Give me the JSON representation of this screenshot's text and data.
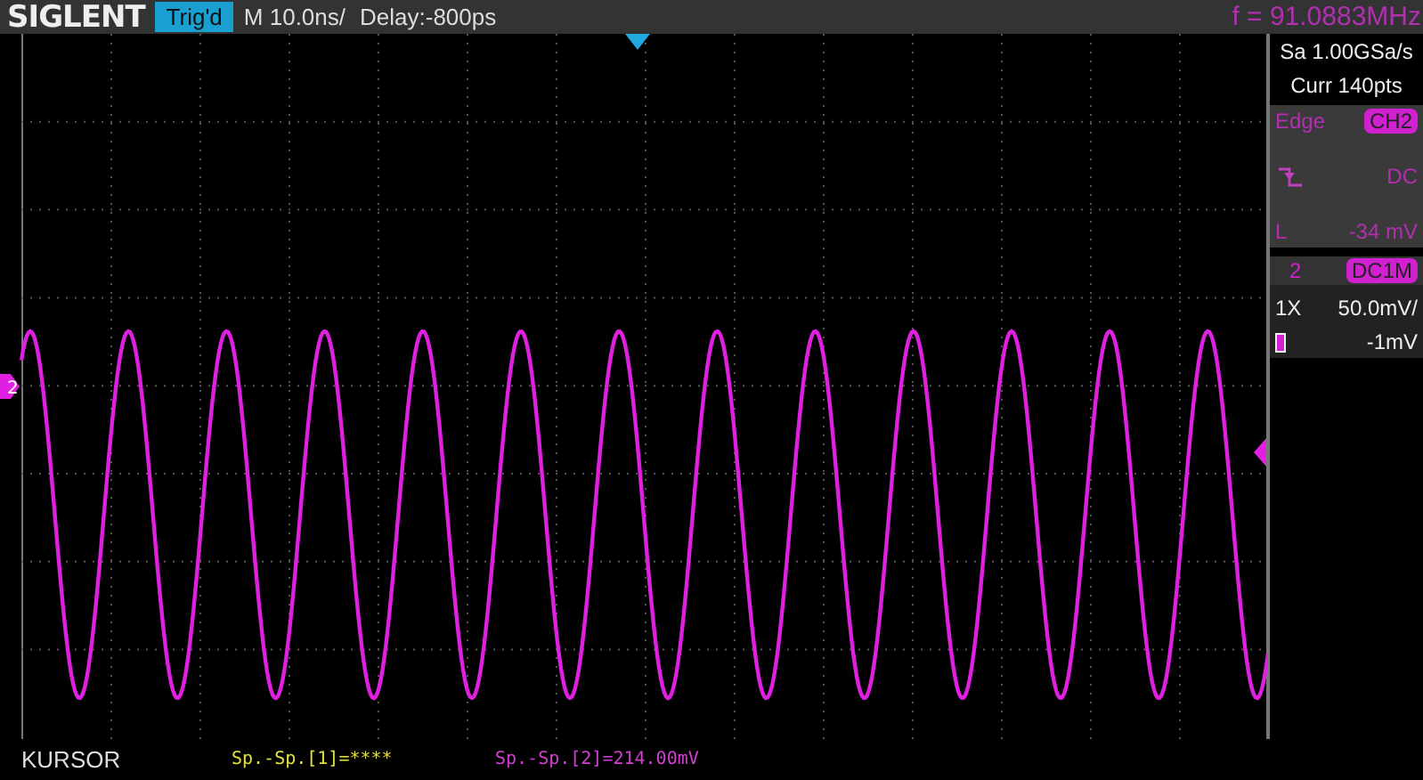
{
  "header": {
    "logo": "SIGLENT",
    "trigger_status": "Trig'd",
    "timebase": "M 10.0ns/",
    "delay": "Delay:-800ps",
    "frequency": "f = 91.0883MHz"
  },
  "acquisition": {
    "sample_rate": "Sa 1.00GSa/s",
    "memory": "Curr 140pts"
  },
  "trigger": {
    "type": "Edge",
    "source": "CH2",
    "coupling": "DC",
    "level_label": "L",
    "level_reading": "-34 mV"
  },
  "channel": {
    "number": "2",
    "coupling": "DC1M",
    "probe": "1X",
    "scale": "50.0mV/",
    "offset": "-1mV"
  },
  "screen": {
    "channel_marker": "2"
  },
  "status_bar": {
    "mode": "KURSOR",
    "readouts": [
      {
        "text": "Sp.-Sp.[1]=****",
        "color": "#e0e040"
      },
      {
        "text": "Sp.-Sp.[2]=214.00mV",
        "color": "#d040d0"
      }
    ]
  }
}
